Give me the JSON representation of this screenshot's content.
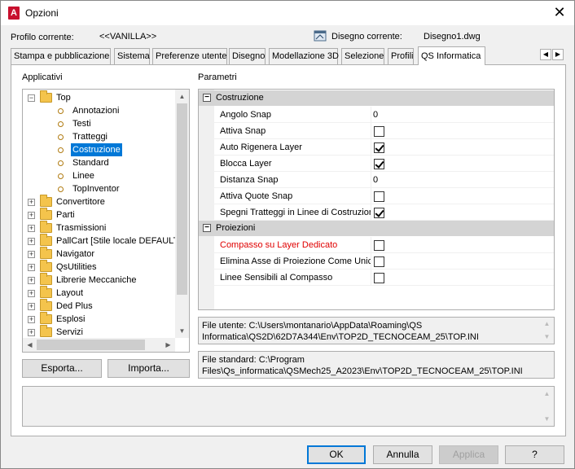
{
  "window": {
    "title": "Opzioni",
    "icon_letter": "A"
  },
  "profile": {
    "label": "Profilo corrente:",
    "value": "<<VANILLA>>"
  },
  "drawing": {
    "label": "Disegno corrente:",
    "value": "Disegno1.dwg"
  },
  "tabs": [
    {
      "label": "Stampa e pubblicazione"
    },
    {
      "label": "Sistema"
    },
    {
      "label": "Preferenze utente"
    },
    {
      "label": "Disegno"
    },
    {
      "label": "Modellazione 3D"
    },
    {
      "label": "Selezione"
    },
    {
      "label": "Profili"
    },
    {
      "label": "QS Informatica"
    }
  ],
  "applicativi": {
    "label": "Applicativi",
    "tree": [
      {
        "label": "Top"
      },
      {
        "label": "Annotazioni"
      },
      {
        "label": "Testi"
      },
      {
        "label": "Tratteggi"
      },
      {
        "label": "Costruzione"
      },
      {
        "label": "Standard"
      },
      {
        "label": "Linee"
      },
      {
        "label": "TopInventor"
      },
      {
        "label": "Convertitore"
      },
      {
        "label": "Parti"
      },
      {
        "label": "Trasmissioni"
      },
      {
        "label": "PallCart [Stile locale DEFAULT]"
      },
      {
        "label": "Navigator"
      },
      {
        "label": "QsUtilities"
      },
      {
        "label": "Librerie Meccaniche"
      },
      {
        "label": "Layout"
      },
      {
        "label": "Ded Plus"
      },
      {
        "label": "Esplosi"
      },
      {
        "label": "Servizi"
      }
    ],
    "export_label": "Esporta...",
    "import_label": "Importa..."
  },
  "parametri": {
    "label": "Parametri",
    "categories": [
      {
        "name": "Costruzione",
        "props": [
          {
            "name": "Angolo Snap",
            "value": "0"
          },
          {
            "name": "Attiva Snap",
            "checked": false
          },
          {
            "name": "Auto Rigenera Layer",
            "checked": true
          },
          {
            "name": "Blocca Layer",
            "checked": true
          },
          {
            "name": "Distanza Snap",
            "value": "0"
          },
          {
            "name": "Attiva Quote Snap",
            "checked": false
          },
          {
            "name": "Spegni Tratteggi in Linee di Costruzione",
            "checked": true
          }
        ]
      },
      {
        "name": "Proiezioni",
        "props": [
          {
            "name": "Compasso su Layer Dedicato",
            "checked": false,
            "color": "#e00000"
          },
          {
            "name": "Elimina Asse di Proiezione Come Unica",
            "checked": false
          },
          {
            "name": "Linee Sensibili al Compasso",
            "checked": false
          }
        ]
      }
    ]
  },
  "files": {
    "user": "File utente: C:\\Users\\montanario\\AppData\\Roaming\\QS Informatica\\QS2D\\62D7A344\\Env\\TOP2D_TECNOCEAM_25\\TOP.INI",
    "standard": "File standard: C:\\Program Files\\Qs_informatica\\QSMech25_A2023\\Env\\TOP2D_TECNOCEAM_25\\TOP.INI"
  },
  "buttons": {
    "ok": "OK",
    "cancel": "Annulla",
    "apply": "Applica",
    "help": "?"
  },
  "colors": {
    "selection": "#0078d7",
    "accent_red": "#e00000",
    "folder": "#f4c44c"
  }
}
